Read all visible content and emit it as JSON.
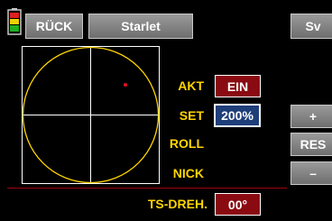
{
  "header": {
    "back_label": "RÜCK",
    "model_name": "Starlet",
    "save_label": "Sv"
  },
  "rows": {
    "akt": {
      "label": "AKT",
      "value": "EIN"
    },
    "set": {
      "label": "SET",
      "value": "200%"
    },
    "roll": {
      "label": "ROLL"
    },
    "nick": {
      "label": "NICK"
    }
  },
  "footer": {
    "ts_label": "TS-DREH.",
    "ts_value": "00°"
  },
  "side_buttons": {
    "plus": "+",
    "reset": "RES",
    "minus": "–"
  },
  "colors": {
    "background": "#000000",
    "gauge_circle": "#ffd400",
    "gauge_cross": "#ffffff",
    "marker": "#e01020",
    "label": "#ffd400",
    "divider": "#a00010",
    "active_value": "#8a0a12",
    "selected_value": "#1f3f7a"
  },
  "icons": {
    "battery": "battery-icon"
  }
}
